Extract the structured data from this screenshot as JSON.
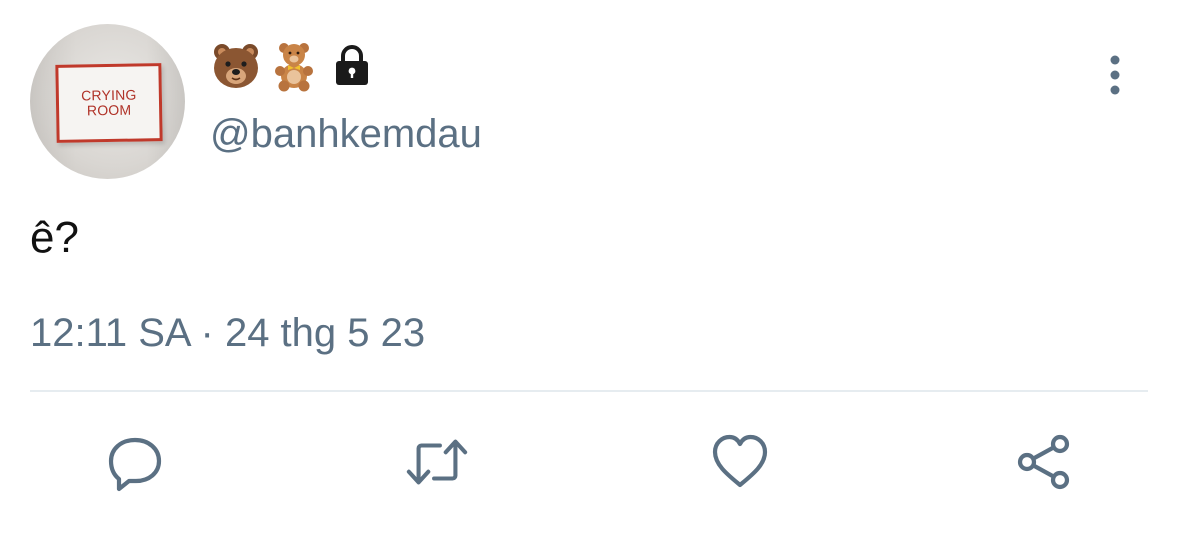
{
  "tweet": {
    "avatar_sign_line1": "CRYING",
    "avatar_sign_line2": "ROOM",
    "display_name_icons": [
      "bear-face-icon",
      "teddy-bear-icon",
      "lock-icon"
    ],
    "handle": "@banhkemdau",
    "text": "ê?",
    "timestamp": "12:11 SA · 24 thg 5 23"
  },
  "actions": [
    "reply-icon",
    "retweet-icon",
    "like-icon",
    "share-icon"
  ],
  "colors": {
    "secondary_text": "#5b7083",
    "primary_text": "#111111",
    "divider": "#e6ecf0",
    "sign_red": "#c0392b"
  }
}
